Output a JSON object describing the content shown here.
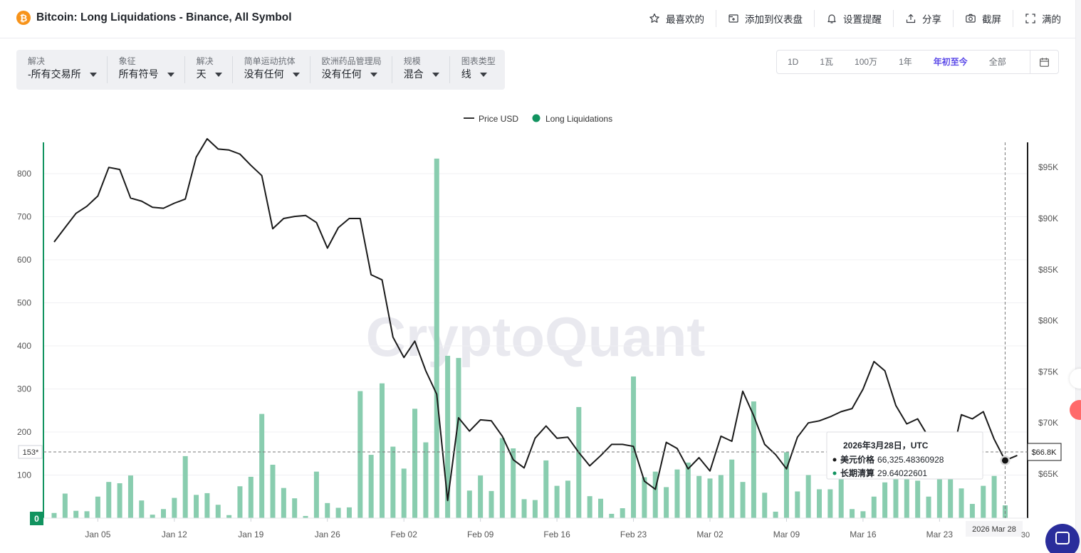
{
  "header": {
    "title": "Bitcoin: Long Liquidations - Binance, All Symbol",
    "actions": [
      {
        "label": "最喜欢的",
        "icon": "star-icon"
      },
      {
        "label": "添加到仪表盘",
        "icon": "dashboard-add-icon"
      },
      {
        "label": "设置提醒",
        "icon": "bell-icon"
      },
      {
        "label": "分享",
        "icon": "share-icon"
      },
      {
        "label": "截屏",
        "icon": "camera-icon"
      },
      {
        "label": "满的",
        "icon": "fullscreen-icon"
      }
    ]
  },
  "filters": [
    {
      "label": "解决",
      "value": "-所有交易所"
    },
    {
      "label": "象征",
      "value": "所有符号"
    },
    {
      "label": "解决",
      "value": "天"
    },
    {
      "label": "简单运动抗体",
      "value": "没有任何"
    },
    {
      "label": "欧洲药品管理局",
      "value": "没有任何"
    },
    {
      "label": "规模",
      "value": "混合"
    },
    {
      "label": "图表类型",
      "value": "线"
    }
  ],
  "ranges": {
    "items": [
      "1D",
      "1瓦",
      "100万",
      "1年",
      "年初至今",
      "全部"
    ],
    "active": "年初至今"
  },
  "legend": {
    "price": "Price USD",
    "liq": "Long Liquidations"
  },
  "watermark": "CryptoQuant",
  "colors": {
    "accent": "#5b49e8",
    "bar": "#89cdaf",
    "price_line": "#1a1a1a",
    "left_axis": "#11935f",
    "brand_orange": "#f7931a"
  },
  "markers": {
    "left_value": "153*",
    "left_zero": "0",
    "right_value": "$66.8K",
    "x_value": "2026 Mar 28",
    "x_partial": "30"
  },
  "tooltip": {
    "date": "2026年3月28日",
    "tz": "，UTC",
    "price_label": "美元价格",
    "price_value": "66,325.48360928",
    "liq_label": "长期清算",
    "liq_value": "29.64022601"
  },
  "chart_data": {
    "type": "bar",
    "x_start": "2026-01-01",
    "x_end": "2026-03-28",
    "x_ticks": [
      "Jan 05",
      "Jan 12",
      "Jan 19",
      "Jan 26",
      "Feb 02",
      "Feb 09",
      "Feb 16",
      "Feb 23",
      "Mar 02",
      "Mar 09",
      "Mar 16",
      "Mar 23"
    ],
    "y_left": {
      "min": 0,
      "max": 800,
      "ticks": [
        "0",
        "100",
        "200",
        "300",
        "400",
        "500",
        "600",
        "700",
        "800"
      ]
    },
    "y_right": {
      "ticks": [
        "$65K",
        "$70K",
        "$75K",
        "$80K",
        "$85K",
        "$90K",
        "$95K"
      ]
    },
    "series": [
      {
        "name": "Long Liquidations",
        "type": "bar",
        "axis": "left",
        "values": [
          12,
          57,
          17,
          16,
          50,
          84,
          81,
          99,
          41,
          8,
          21,
          47,
          144,
          54,
          58,
          31,
          7,
          74,
          96,
          242,
          124,
          70,
          46,
          5,
          108,
          35,
          24,
          25,
          295,
          147,
          313,
          166,
          115,
          254,
          176,
          835,
          377,
          372,
          64,
          99,
          63,
          186,
          162,
          44,
          42,
          134,
          75,
          87,
          258,
          51,
          45,
          10,
          23,
          329,
          95,
          108,
          72,
          113,
          129,
          98,
          92,
          100,
          136,
          84,
          271,
          59,
          15,
          153,
          62,
          100,
          67,
          67,
          93,
          21,
          16,
          50,
          83,
          98,
          108,
          87,
          50,
          95,
          117,
          69,
          33,
          75,
          98,
          29.64022601
        ]
      },
      {
        "name": "Price USD",
        "type": "line",
        "axis": "right",
        "values": [
          87700,
          89100,
          90500,
          91200,
          92200,
          95000,
          94800,
          92000,
          91700,
          91100,
          91000,
          91500,
          91900,
          96000,
          97800,
          96800,
          96700,
          96300,
          95200,
          94200,
          89000,
          90000,
          90200,
          90300,
          89600,
          87100,
          89100,
          90000,
          90000,
          84500,
          84000,
          78400,
          76400,
          78000,
          75100,
          72800,
          62400,
          70500,
          69200,
          70300,
          70200,
          68700,
          66400,
          65600,
          68500,
          69700,
          68500,
          68600,
          67100,
          65800,
          66800,
          67900,
          67900,
          67700,
          64300,
          63500,
          68100,
          67500,
          65500,
          66600,
          65300,
          68700,
          68200,
          73100,
          70700,
          67900,
          66900,
          65500,
          68600,
          70000,
          70200,
          70600,
          71100,
          71400,
          73300,
          76000,
          75100,
          71700,
          69900,
          70400,
          68600,
          67500,
          66000,
          70800,
          70400,
          71100,
          68400,
          66325.48
        ]
      }
    ]
  }
}
